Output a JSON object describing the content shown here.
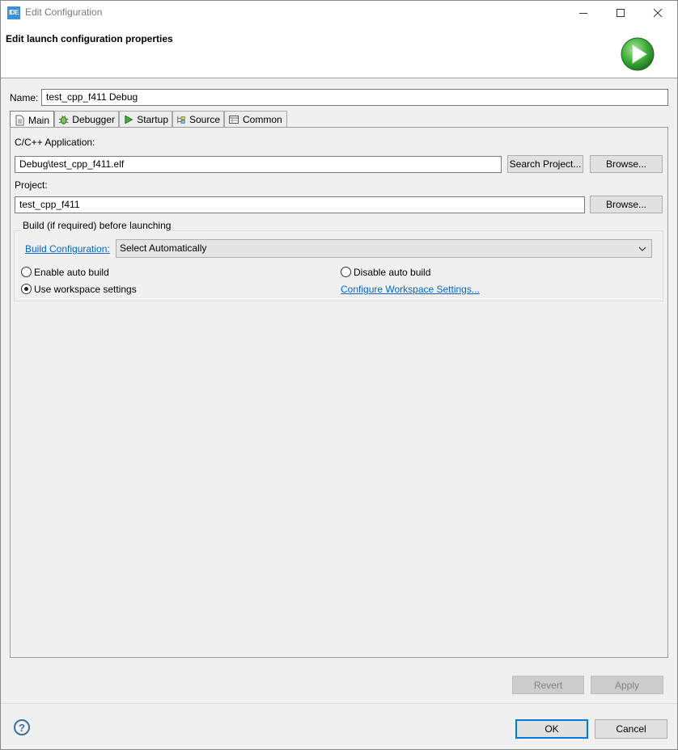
{
  "window": {
    "app_icon_text": "IDE",
    "title": "Edit Configuration"
  },
  "header": {
    "title": "Edit launch configuration properties",
    "icon": "run-icon"
  },
  "name_field": {
    "label": "Name:",
    "value": "test_cpp_f411 Debug"
  },
  "tabs": [
    {
      "label": "Main",
      "icon": "document-icon",
      "active": true
    },
    {
      "label": "Debugger",
      "icon": "bug-icon",
      "active": false
    },
    {
      "label": "Startup",
      "icon": "play-icon",
      "active": false
    },
    {
      "label": "Source",
      "icon": "source-icon",
      "active": false
    },
    {
      "label": "Common",
      "icon": "table-icon",
      "active": false
    }
  ],
  "main": {
    "application_label": "C/C++ Application:",
    "application_value": "Debug\\test_cpp_f411.elf",
    "search_project_label": "Search Project...",
    "browse_label": "Browse...",
    "project_label": "Project:",
    "project_value": "test_cpp_f411",
    "build_group": {
      "title": "Build (if required) before launching",
      "build_config_link": "Build Configuration:",
      "build_config_value": "Select Automatically",
      "enable_auto_build": "Enable auto build",
      "disable_auto_build": "Disable auto build",
      "use_workspace_settings": "Use workspace settings",
      "configure_workspace_link": "Configure Workspace Settings...",
      "selected_option": "use_workspace_settings"
    }
  },
  "footer": {
    "revert_label": "Revert",
    "apply_label": "Apply",
    "ok_label": "OK",
    "cancel_label": "Cancel",
    "help_icon": "help-icon"
  },
  "colors": {
    "link": "#0066cc",
    "default_button_border": "#0078d7",
    "run_icon_green": "#3fae3a"
  }
}
